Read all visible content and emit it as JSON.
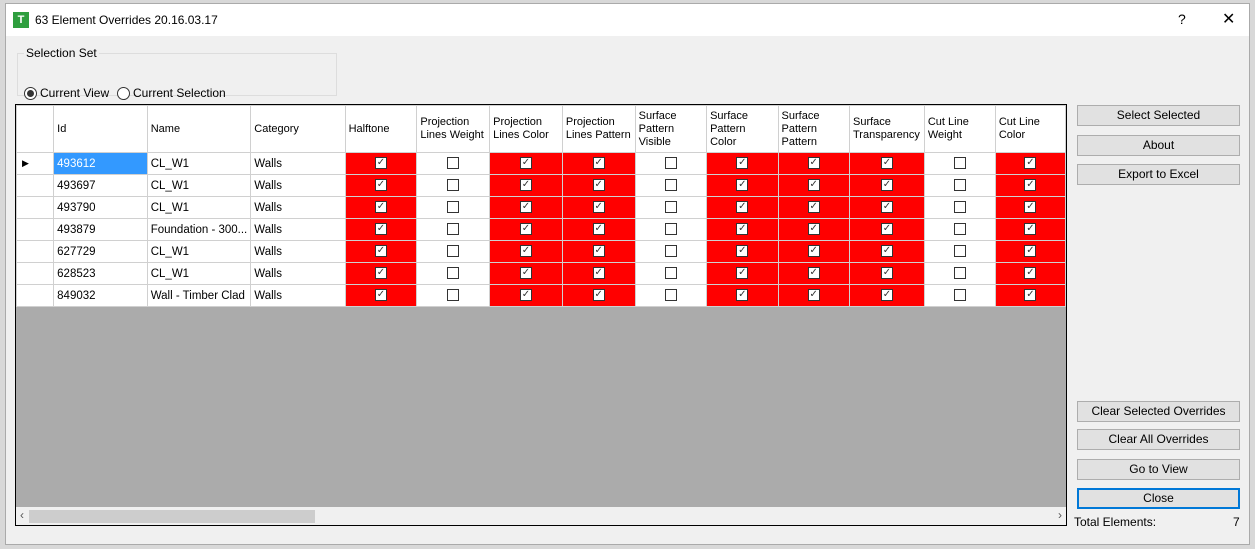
{
  "window": {
    "title": "63 Element Overrides 20.16.03.17",
    "help": "?",
    "close": "✕",
    "logo": "T"
  },
  "selection_set": {
    "label": "Selection Set",
    "options": [
      {
        "label": "Current View",
        "selected": true
      },
      {
        "label": "Current Selection",
        "selected": false
      }
    ]
  },
  "grid": {
    "columns": [
      "Id",
      "Name",
      "Category",
      "Halftone",
      "Projection Lines Weight",
      "Projection Lines Color",
      "Projection Lines Pattern",
      "Surface Pattern Visible",
      "Surface Pattern Color",
      "Surface Pattern Pattern",
      "Surface Transparency",
      "Cut Line Weight",
      "Cut Line Color"
    ],
    "rows": [
      {
        "id": "493612",
        "name": "CL_W1",
        "category": "Walls"
      },
      {
        "id": "493697",
        "name": "CL_W1",
        "category": "Walls"
      },
      {
        "id": "493790",
        "name": "CL_W1",
        "category": "Walls"
      },
      {
        "id": "493879",
        "name": "Foundation - 300...",
        "category": "Walls"
      },
      {
        "id": "627729",
        "name": "CL_W1",
        "category": "Walls"
      },
      {
        "id": "628523",
        "name": "CL_W1",
        "category": "Walls"
      },
      {
        "id": "849032",
        "name": "Wall - Timber Clad",
        "category": "Walls"
      }
    ],
    "checks": [
      true,
      false,
      true,
      true,
      false,
      true,
      true,
      true,
      false,
      true
    ],
    "override_color": "#ff0000",
    "selected_color": "#3399ff"
  },
  "buttons": {
    "select_selected": "Select Selected",
    "about": "About",
    "export": "Export to Excel",
    "clear_selected": "Clear Selected Overrides",
    "clear_all": "Clear All Overrides",
    "go_to_view": "Go to View",
    "close": "Close"
  },
  "status": {
    "total_label": "Total Elements:",
    "total_value": "7"
  }
}
